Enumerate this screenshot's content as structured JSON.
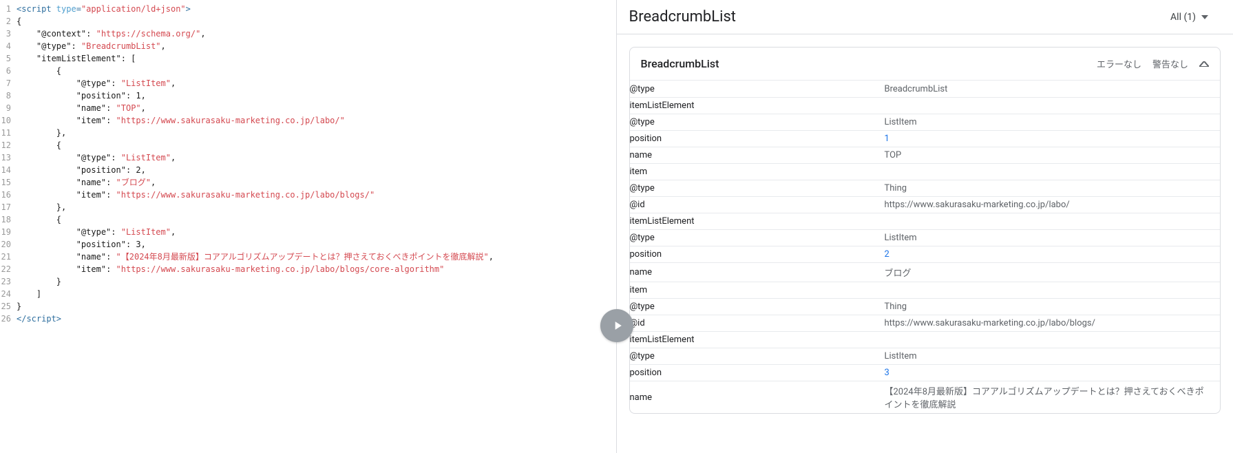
{
  "heading": {
    "title": "BreadcrumbList",
    "filter": "All (1)"
  },
  "panel": {
    "title": "BreadcrumbList",
    "status_error": "エラーなし",
    "status_warn": "警告なし"
  },
  "rows": [
    {
      "indent": 1,
      "key": "@type",
      "val": "BreadcrumbList",
      "link": false
    },
    {
      "indent": 1,
      "key": "itemListElement",
      "val": "",
      "link": false
    },
    {
      "indent": 2,
      "key": "@type",
      "val": "ListItem",
      "link": false
    },
    {
      "indent": 2,
      "key": "position",
      "val": "1",
      "link": true
    },
    {
      "indent": 2,
      "key": "name",
      "val": "TOP",
      "link": false
    },
    {
      "indent": 2,
      "key": "item",
      "val": "",
      "link": false
    },
    {
      "indent": 3,
      "key": "@type",
      "val": "Thing",
      "link": false
    },
    {
      "indent": 3,
      "key": "@id",
      "val": "https://www.sakurasaku-marketing.co.jp/labo/",
      "link": false
    },
    {
      "indent": 1,
      "key": "itemListElement",
      "val": "",
      "link": false
    },
    {
      "indent": 2,
      "key": "@type",
      "val": "ListItem",
      "link": false
    },
    {
      "indent": 2,
      "key": "position",
      "val": "2",
      "link": true
    },
    {
      "indent": 2,
      "key": "name",
      "val": "ブログ",
      "link": false
    },
    {
      "indent": 2,
      "key": "item",
      "val": "",
      "link": false
    },
    {
      "indent": 3,
      "key": "@type",
      "val": "Thing",
      "link": false
    },
    {
      "indent": 3,
      "key": "@id",
      "val": "https://www.sakurasaku-marketing.co.jp/labo/blogs/",
      "link": false
    },
    {
      "indent": 1,
      "key": "itemListElement",
      "val": "",
      "link": false
    },
    {
      "indent": 2,
      "key": "@type",
      "val": "ListItem",
      "link": false
    },
    {
      "indent": 2,
      "key": "position",
      "val": "3",
      "link": true
    },
    {
      "indent": 2,
      "key": "name",
      "val": "【2024年8月最新版】コアアルゴリズムアップデートとは？押さえておくべきポイントを徹底解説",
      "link": false
    }
  ],
  "code": {
    "lines": [
      [
        {
          "c": "tag",
          "t": "<script "
        },
        {
          "c": "attr",
          "t": "type"
        },
        {
          "c": "tag",
          "t": "="
        },
        {
          "c": "str",
          "t": "\"application/ld+json\""
        },
        {
          "c": "tag",
          "t": ">"
        }
      ],
      [
        {
          "c": "punct",
          "t": "{"
        }
      ],
      [
        {
          "c": "punct",
          "t": "    "
        },
        {
          "c": "key",
          "t": "\"@context\""
        },
        {
          "c": "punct",
          "t": ": "
        },
        {
          "c": "str",
          "t": "\"https://schema.org/\""
        },
        {
          "c": "punct",
          "t": ","
        }
      ],
      [
        {
          "c": "punct",
          "t": "    "
        },
        {
          "c": "key",
          "t": "\"@type\""
        },
        {
          "c": "punct",
          "t": ": "
        },
        {
          "c": "str",
          "t": "\"BreadcrumbList\""
        },
        {
          "c": "punct",
          "t": ","
        }
      ],
      [
        {
          "c": "punct",
          "t": "    "
        },
        {
          "c": "key",
          "t": "\"itemListElement\""
        },
        {
          "c": "punct",
          "t": ": ["
        }
      ],
      [
        {
          "c": "punct",
          "t": "        {"
        }
      ],
      [
        {
          "c": "punct",
          "t": "            "
        },
        {
          "c": "key",
          "t": "\"@type\""
        },
        {
          "c": "punct",
          "t": ": "
        },
        {
          "c": "str",
          "t": "\"ListItem\""
        },
        {
          "c": "punct",
          "t": ","
        }
      ],
      [
        {
          "c": "punct",
          "t": "            "
        },
        {
          "c": "key",
          "t": "\"position\""
        },
        {
          "c": "punct",
          "t": ": 1,"
        }
      ],
      [
        {
          "c": "punct",
          "t": "            "
        },
        {
          "c": "key",
          "t": "\"name\""
        },
        {
          "c": "punct",
          "t": ": "
        },
        {
          "c": "str",
          "t": "\"TOP\""
        },
        {
          "c": "punct",
          "t": ","
        }
      ],
      [
        {
          "c": "punct",
          "t": "            "
        },
        {
          "c": "key",
          "t": "\"item\""
        },
        {
          "c": "punct",
          "t": ": "
        },
        {
          "c": "str",
          "t": "\"https://www.sakurasaku-marketing.co.jp/labo/\""
        }
      ],
      [
        {
          "c": "punct",
          "t": "        },"
        }
      ],
      [
        {
          "c": "punct",
          "t": "        {"
        }
      ],
      [
        {
          "c": "punct",
          "t": "            "
        },
        {
          "c": "key",
          "t": "\"@type\""
        },
        {
          "c": "punct",
          "t": ": "
        },
        {
          "c": "str",
          "t": "\"ListItem\""
        },
        {
          "c": "punct",
          "t": ","
        }
      ],
      [
        {
          "c": "punct",
          "t": "            "
        },
        {
          "c": "key",
          "t": "\"position\""
        },
        {
          "c": "punct",
          "t": ": 2,"
        }
      ],
      [
        {
          "c": "punct",
          "t": "            "
        },
        {
          "c": "key",
          "t": "\"name\""
        },
        {
          "c": "punct",
          "t": ": "
        },
        {
          "c": "str",
          "t": "\"ブログ\""
        },
        {
          "c": "punct",
          "t": ","
        }
      ],
      [
        {
          "c": "punct",
          "t": "            "
        },
        {
          "c": "key",
          "t": "\"item\""
        },
        {
          "c": "punct",
          "t": ": "
        },
        {
          "c": "str",
          "t": "\"https://www.sakurasaku-marketing.co.jp/labo/blogs/\""
        }
      ],
      [
        {
          "c": "punct",
          "t": "        },"
        }
      ],
      [
        {
          "c": "punct",
          "t": "        {"
        }
      ],
      [
        {
          "c": "punct",
          "t": "            "
        },
        {
          "c": "key",
          "t": "\"@type\""
        },
        {
          "c": "punct",
          "t": ": "
        },
        {
          "c": "str",
          "t": "\"ListItem\""
        },
        {
          "c": "punct",
          "t": ","
        }
      ],
      [
        {
          "c": "punct",
          "t": "            "
        },
        {
          "c": "key",
          "t": "\"position\""
        },
        {
          "c": "punct",
          "t": ": 3,"
        }
      ],
      [
        {
          "c": "punct",
          "t": "            "
        },
        {
          "c": "key",
          "t": "\"name\""
        },
        {
          "c": "punct",
          "t": ": "
        },
        {
          "c": "str",
          "t": "\"【2024年8月最新版】コアアルゴリズムアップデートとは？押さえておくべきポイントを徹底解説\""
        },
        {
          "c": "punct",
          "t": ","
        }
      ],
      [
        {
          "c": "punct",
          "t": "            "
        },
        {
          "c": "key",
          "t": "\"item\""
        },
        {
          "c": "punct",
          "t": ": "
        },
        {
          "c": "str",
          "t": "\"https://www.sakurasaku-marketing.co.jp/labo/blogs/core-algorithm\""
        }
      ],
      [
        {
          "c": "punct",
          "t": "        }"
        }
      ],
      [
        {
          "c": "punct",
          "t": "    ]"
        }
      ],
      [
        {
          "c": "punct",
          "t": "}"
        }
      ],
      [
        {
          "c": "tag",
          "t": "</scr"
        },
        {
          "c": "tag",
          "t": "ipt>"
        }
      ]
    ]
  }
}
